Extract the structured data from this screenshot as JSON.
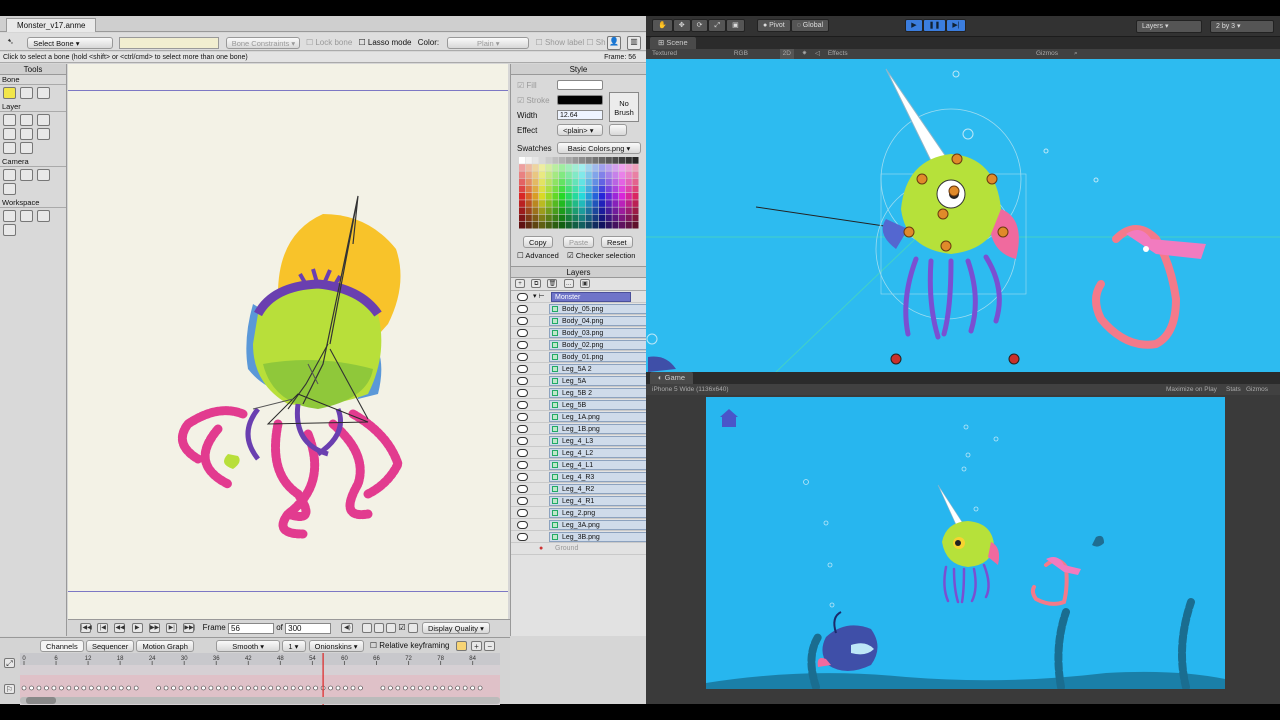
{
  "doc_tab": "Monster_v17.anme",
  "toolbar": {
    "select_bone": "Select Bone",
    "bone_constraints": "Bone Constraints",
    "lock_bone": "Lock bone",
    "lasso_mode": "Lasso mode",
    "color_label": "Color:",
    "color_value": "Plain",
    "show_label": "Show label",
    "sh": "Sh"
  },
  "status": {
    "hint": "Click to select a bone (hold <shift> or <ctrl/cmd> to select more than one bone)",
    "frame": "Frame: 56"
  },
  "tools": {
    "title": "Tools",
    "sections": [
      {
        "name": "Bone",
        "icons": [
          "select-bone-icon",
          "transform-bone-icon",
          "bone-strength-icon"
        ]
      },
      {
        "name": "Layer",
        "icons": [
          "translate-layer-icon",
          "move-layer-icon",
          "rotate-layer-icon",
          "scale-layer-icon",
          "flip-layer-icon",
          "set-origin-icon",
          "switch-layer-icon",
          "eyedropper-icon"
        ]
      },
      {
        "name": "Camera",
        "icons": [
          "track-camera-icon",
          "zoom-camera-icon",
          "roll-camera-icon",
          "pan-tilt-camera-icon"
        ]
      },
      {
        "name": "Workspace",
        "icons": [
          "hand-icon",
          "zoom-icon",
          "rotate-workspace-icon",
          "orbit-icon"
        ]
      }
    ]
  },
  "style": {
    "title": "Style",
    "fill": "Fill",
    "stroke": "Stroke",
    "width_label": "Width",
    "width_value": "12.64",
    "effect_label": "Effect",
    "effect_value": "<plain>",
    "no_brush": "No Brush",
    "swatches_label": "Swatches",
    "swatches_value": "Basic Colors.png",
    "copy": "Copy",
    "paste": "Paste",
    "reset": "Reset",
    "advanced": "Advanced",
    "checker": "Checker selection"
  },
  "layers": {
    "title": "Layers",
    "root": "Monster",
    "items": [
      "Body_05.png",
      "Body_04.png",
      "Body_03.png",
      "Body_02.png",
      "Body_01.png",
      "Leg_5A 2",
      "Leg_5A",
      "Leg_5B 2",
      "Leg_5B",
      "Leg_1A.png",
      "Leg_1B.png",
      "Leg_4_L3",
      "Leg_4_L2",
      "Leg_4_L1",
      "Leg_4_R3",
      "Leg_4_R2",
      "Leg_4_R1",
      "Leg_2.png",
      "Leg_3A.png",
      "Leg_3B.png"
    ],
    "ground": "Ground"
  },
  "playback": {
    "frame_label": "Frame",
    "frame_value": "56",
    "of_label": "of",
    "total": "300",
    "display_quality": "Display Quality"
  },
  "timeline": {
    "tabs": [
      "Channels",
      "Sequencer",
      "Motion Graph"
    ],
    "interp": "Smooth",
    "interp_count": "1",
    "onionskins": "Onionskins",
    "relative_keyframing": "Relative keyframing",
    "ticks": [
      "0",
      "6",
      "12",
      "18",
      "24",
      "30",
      "36",
      "42",
      "48",
      "54",
      "60",
      "66",
      "72",
      "78",
      "84"
    ],
    "playhead_frame": 56,
    "max_frame": 88
  },
  "unity": {
    "pivot": "Pivot",
    "global": "Global",
    "layers": "Layers",
    "layout": "2 by 3",
    "scene_tab": "Scene",
    "textured": "Textured",
    "rgb": "RGB",
    "mode_2d": "2D",
    "effects": "Effects",
    "gizmos": "Gizmos",
    "game_tab": "Game",
    "resolution": "iPhone 5 Wide (1136x640)",
    "maximize": "Maximize on Play",
    "stats": "Stats",
    "gizmos_game": "Gizmos"
  },
  "colors": {
    "scene_bg": "#2dbbf0",
    "game_bg": "#27b6ef",
    "canvas_bg": "#f3f2e6",
    "accent_blue": "#3b7ddd"
  }
}
